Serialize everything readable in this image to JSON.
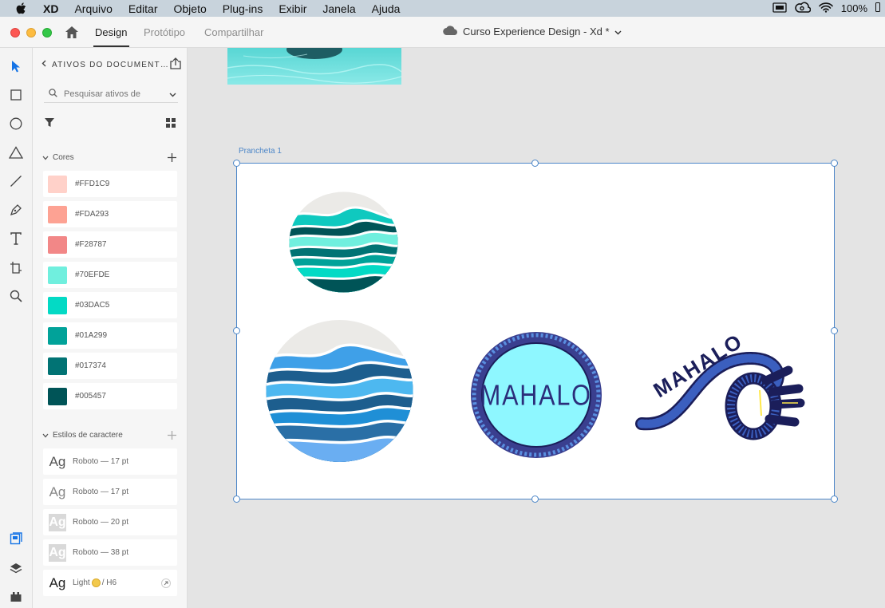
{
  "menubar": {
    "app": "XD",
    "items": [
      "Arquivo",
      "Editar",
      "Objeto",
      "Plug-ins",
      "Exibir",
      "Janela",
      "Ajuda"
    ],
    "battery": "100%"
  },
  "window": {
    "tabs": {
      "design": "Design",
      "prototype": "Protótipo",
      "share": "Compartilhar"
    },
    "document_title": "Curso Experience Design - Xd *"
  },
  "assets": {
    "title": "ATIVOS DO DOCUMENT…",
    "search_placeholder": "Pesquisar ativos de",
    "colors_label": "Cores",
    "colors": [
      {
        "hex": "#FFD1C9",
        "color": "#FFD1C9"
      },
      {
        "hex": "#FDA293",
        "color": "#FDA293"
      },
      {
        "hex": "#F28787",
        "color": "#F28787"
      },
      {
        "hex": "#70EFDE",
        "color": "#70EFDE"
      },
      {
        "hex": "#03DAC5",
        "color": "#03DAC5"
      },
      {
        "hex": "#01A299",
        "color": "#01A299"
      },
      {
        "hex": "#017374",
        "color": "#017374"
      },
      {
        "hex": "#005457",
        "color": "#005457"
      }
    ],
    "char_styles_label": "Estilos de caractere",
    "char_styles": [
      {
        "ag": "Ag",
        "label": "Roboto — 17 pt",
        "variant": "normal"
      },
      {
        "ag": "Ag",
        "label": "Roboto — 17 pt",
        "variant": "light"
      },
      {
        "ag": "Ag",
        "label": "Roboto — 20 pt",
        "variant": "grey"
      },
      {
        "ag": "Ag",
        "label": "Roboto — 38 pt",
        "variant": "grey"
      },
      {
        "ag": "Ag",
        "label": "Light",
        "suffix": " / H6",
        "variant": "dark"
      }
    ]
  },
  "canvas": {
    "artboard_name": "Prancheta 1",
    "mahalo_circle_text": "MAHALO",
    "mahalo_wave_text": "MAHALO"
  }
}
